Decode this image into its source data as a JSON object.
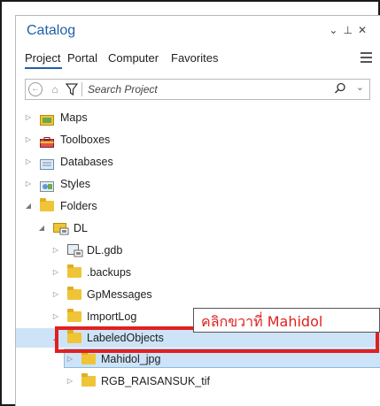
{
  "panel": {
    "title": "Catalog",
    "controls": [
      "⌄",
      "⊥",
      "✕"
    ]
  },
  "tabs": [
    {
      "label": "Project",
      "active": true
    },
    {
      "label": "Portal",
      "active": false
    },
    {
      "label": "Computer",
      "active": false
    },
    {
      "label": "Favorites",
      "active": false
    }
  ],
  "search": {
    "placeholder": "Search Project"
  },
  "tree": [
    {
      "label": "Maps",
      "icon": "map-icon",
      "expanded": false
    },
    {
      "label": "Toolboxes",
      "icon": "toolbox-icon",
      "expanded": false
    },
    {
      "label": "Databases",
      "icon": "database-icon",
      "expanded": false
    },
    {
      "label": "Styles",
      "icon": "style-icon",
      "expanded": false
    },
    {
      "label": "Folders",
      "icon": "folder-icon",
      "expanded": true
    },
    {
      "label": "DL",
      "icon": "folder-connection-icon",
      "expanded": true
    },
    {
      "label": "DL.gdb",
      "icon": "geodatabase-icon",
      "expanded": false
    },
    {
      "label": ".backups",
      "icon": "folder-icon",
      "expanded": false
    },
    {
      "label": "GpMessages",
      "icon": "folder-icon",
      "expanded": false
    },
    {
      "label": "ImportLog",
      "icon": "folder-icon",
      "expanded": false
    },
    {
      "label": "LabeledObjects",
      "icon": "folder-icon",
      "expanded": true
    },
    {
      "label": "Mahidol_jpg",
      "icon": "folder-icon",
      "expanded": false
    },
    {
      "label": "RGB_RAISANSUK_tif",
      "icon": "folder-icon",
      "expanded": false
    }
  ],
  "annotation": {
    "callout_text": "คลิกขวาที่ Mahidol",
    "highlight_color": "#e0201f"
  },
  "colors": {
    "accent": "#1f5fa8",
    "folder": "#f0c437",
    "selection": "#cde3f7"
  }
}
